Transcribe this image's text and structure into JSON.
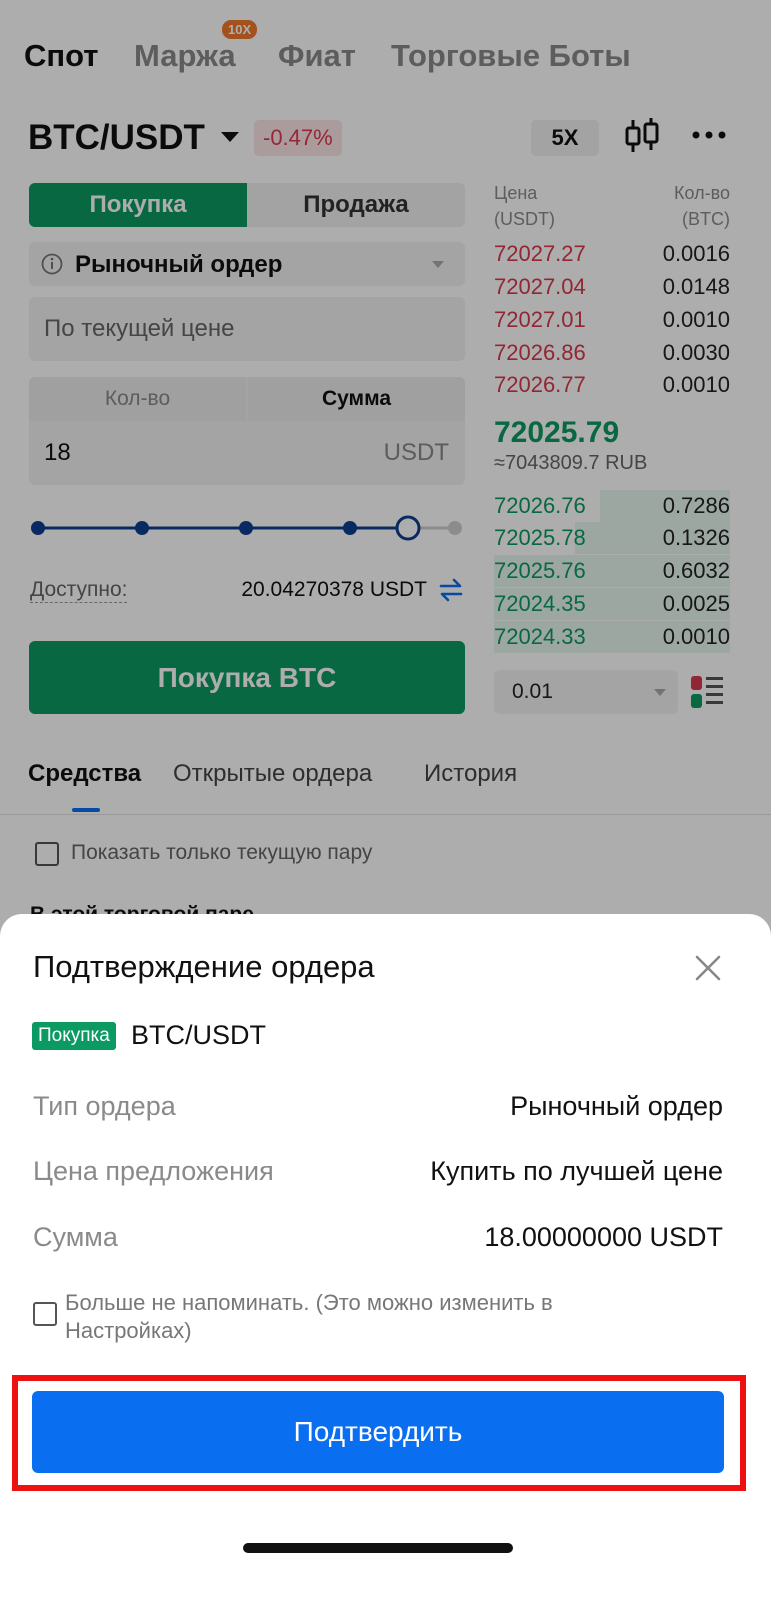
{
  "top_tabs": {
    "spot": "Спот",
    "margin": "Маржа",
    "margin_badge": "10X",
    "fiat": "Фиат",
    "bots": "Торговые Боты"
  },
  "header": {
    "pair": "BTC/USDT",
    "change": "-0.47%",
    "leverage": "5X"
  },
  "trade_form": {
    "buy_tab": "Покупка",
    "sell_tab": "Продажа",
    "order_type": "Рыночный ордер",
    "price_placeholder": "По текущей цене",
    "qty_tab": "Кол-во",
    "sum_tab": "Сумма",
    "amount_value": "18",
    "amount_unit": "USDT",
    "slider_percent": 90,
    "available_label": "Доступно:",
    "available_value": "20.04270378 USDT",
    "buy_button": "Покупка  BTC"
  },
  "orderbook": {
    "price_header_1": "Цена",
    "price_header_2": "(USDT)",
    "qty_header_1": "Кол-во",
    "qty_header_2": "(BTC)",
    "asks": [
      {
        "price": "72027.27",
        "qty": "0.0016"
      },
      {
        "price": "72027.04",
        "qty": "0.0148"
      },
      {
        "price": "72027.01",
        "qty": "0.0010"
      },
      {
        "price": "72026.86",
        "qty": "0.0030"
      },
      {
        "price": "72026.77",
        "qty": "0.0010"
      }
    ],
    "last_price": "72025.79",
    "last_price_rub": "≈7043809.7 RUB",
    "bids": [
      {
        "price": "72026.76",
        "qty": "0.7286"
      },
      {
        "price": "72025.78",
        "qty": "0.1326"
      },
      {
        "price": "72025.76",
        "qty": "0.6032"
      },
      {
        "price": "72024.35",
        "qty": "0.0025"
      },
      {
        "price": "72024.33",
        "qty": "0.0010"
      }
    ],
    "step": "0.01"
  },
  "bottom_tabs": {
    "assets": "Средства",
    "open_orders": "Открытые ордера",
    "history": "История",
    "show_current_pair": "Показать только текущую пару",
    "in_this_pair": "В этой торговой паре"
  },
  "confirm_sheet": {
    "title": "Подтверждение ордера",
    "side_badge": "Покупка",
    "pair": "BTC/USDT",
    "order_type_label": "Тип ордера",
    "order_type_value": "Рыночный ордер",
    "offer_price_label": "Цена предложения",
    "offer_price_value": "Купить по лучшей цене",
    "sum_label": "Сумма",
    "sum_value": "18.00000000 USDT",
    "dont_remind": "Больше не напоминать. (Это можно изменить в Настройках)",
    "confirm_button": "Подтвердить"
  },
  "colors": {
    "buy_green": "#0b9a62",
    "sell_red": "#d8394b",
    "confirm_blue": "#0a6ef0",
    "highlight_red": "#ee1111"
  }
}
